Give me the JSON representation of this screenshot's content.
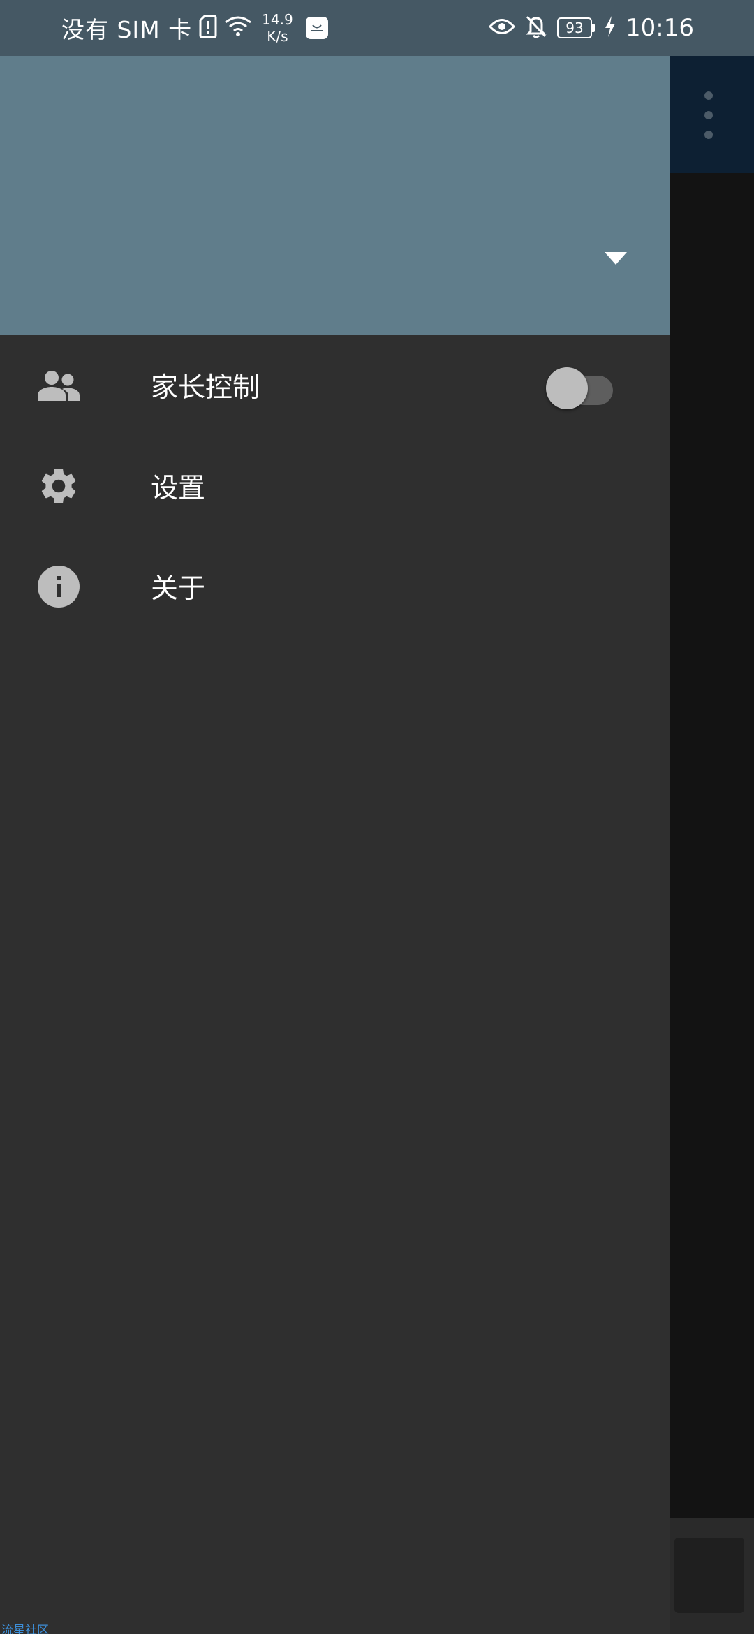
{
  "status_bar": {
    "carrier": "没有 SIM 卡",
    "speed_value": "14.9",
    "speed_unit": "K/s",
    "battery": "93",
    "time": "10:16",
    "store_icon": "huawei-appgallery-icon",
    "icons": [
      "sim-alert-icon",
      "wifi-icon",
      "eye-icon",
      "bell-off-icon",
      "charging-icon"
    ]
  },
  "drawer": {
    "header_color": "#607d8b",
    "background_color": "#2f2f2f",
    "account_toggle_icon": "dropdown-triangle-icon",
    "items": [
      {
        "label": "家长控制",
        "icon": "people-icon",
        "toggle": true,
        "toggle_on": false
      },
      {
        "label": "设置",
        "icon": "gear-icon"
      },
      {
        "label": "关于",
        "icon": "info-icon"
      }
    ]
  },
  "background_app": {
    "appbar_color": "#0d2033",
    "overflow_icon": "more-vert-icon"
  },
  "watermark": "流星社区"
}
